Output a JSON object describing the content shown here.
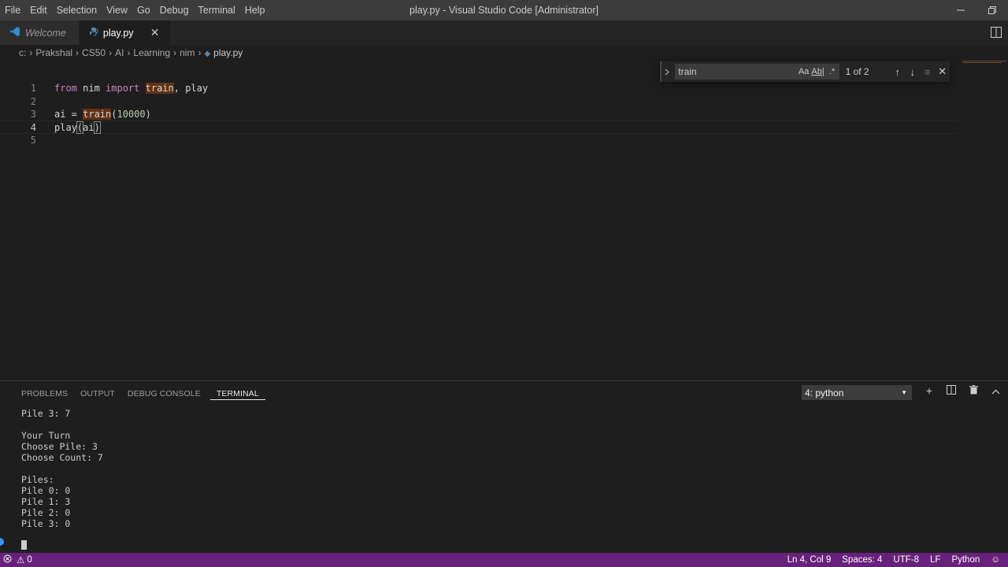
{
  "menu": [
    "File",
    "Edit",
    "Selection",
    "View",
    "Go",
    "Debug",
    "Terminal",
    "Help"
  ],
  "window_title": "play.py - Visual Studio Code [Administrator]",
  "tabs": [
    {
      "label": "Welcome",
      "active": false
    },
    {
      "label": "play.py",
      "active": true
    }
  ],
  "breadcrumb": [
    "c:",
    "Prakshal",
    "CS50",
    "AI",
    "Learning",
    "nim",
    "play.py"
  ],
  "editor": {
    "lines": [
      {
        "num": "1"
      },
      {
        "num": "2"
      },
      {
        "num": "3"
      },
      {
        "num": "4"
      },
      {
        "num": "5"
      }
    ],
    "tokens": {
      "from": "from",
      "nim": " nim ",
      "import": "import",
      "train": "train",
      "play_import": ", play",
      "ai_assign": "ai = ",
      "train_call": "train",
      "paren_open": "(",
      "arg": "10000",
      "paren_close": ")",
      "play_call": "play",
      "play_open": "(",
      "play_arg": "ai",
      "play_close": ")"
    }
  },
  "find": {
    "query": "train",
    "match_case": "Aa",
    "whole_word": "Ab|",
    "regex": ".*",
    "count": "1 of 2"
  },
  "panel": {
    "tabs": [
      "PROBLEMS",
      "OUTPUT",
      "DEBUG CONSOLE",
      "TERMINAL"
    ],
    "active_tab": "TERMINAL",
    "terminal_select": "4: python",
    "output": "Pile 3: 7\n\nYour Turn\nChoose Pile: 3\nChoose Count: 7\n\nPiles:\nPile 0: 0\nPile 1: 3\nPile 2: 0\nPile 3: 0"
  },
  "status": {
    "problems": "0",
    "position": "Ln 4, Col 9",
    "spaces": "Spaces: 4",
    "encoding": "UTF-8",
    "eol": "LF",
    "language": "Python"
  },
  "colors": {
    "statusbar": "#68217a",
    "editor_bg": "#1e1e1e",
    "keyword": "#c586c0",
    "number": "#b5cea8",
    "find_highlight": "#ea5c00"
  }
}
